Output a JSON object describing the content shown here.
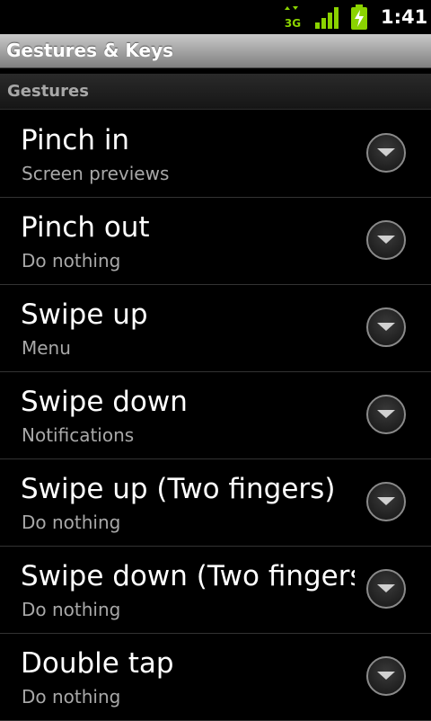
{
  "status_bar": {
    "network_type": "3G",
    "time": "1:41",
    "signal_icon": "signal-bars-icon",
    "battery_icon": "battery-charging-icon",
    "accent_color": "#8bd300"
  },
  "title_bar": {
    "title": "Gestures & Keys"
  },
  "section": {
    "label": "Gestures"
  },
  "gestures": [
    {
      "title": "Pinch in",
      "summary": "Screen previews"
    },
    {
      "title": "Pinch out",
      "summary": "Do nothing"
    },
    {
      "title": "Swipe up",
      "summary": "Menu"
    },
    {
      "title": "Swipe down",
      "summary": "Notifications"
    },
    {
      "title": "Swipe up (Two fingers)",
      "summary": "Do nothing"
    },
    {
      "title": "Swipe down (Two fingers)",
      "summary": "Do nothing"
    },
    {
      "title": "Double tap",
      "summary": "Do nothing"
    }
  ]
}
